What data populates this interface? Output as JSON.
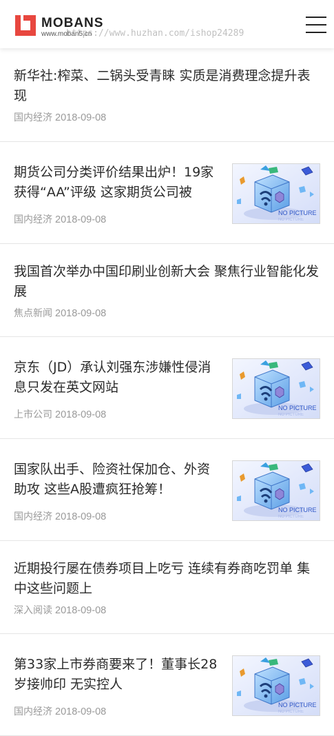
{
  "header": {
    "logo_name": "MOBANS",
    "logo_url": "www.moban5.cn",
    "watermark": "https://www.huzhan.com/ishop24289",
    "menu_icon": "hamburger-menu-icon"
  },
  "thumb": {
    "label": "NO PICTURE",
    "icon": "no-picture-placeholder-image"
  },
  "articles": [
    {
      "title": "新华社:榨菜、二锅头受青睐 实质是消费理念提升表现",
      "category": "国内经济",
      "date": "2018-09-08",
      "has_image": false
    },
    {
      "title": "期货公司分类评价结果出炉！19家获得“AA”评级 这家期货公司被",
      "category": "国内经济",
      "date": "2018-09-08",
      "has_image": true
    },
    {
      "title": "我国首次举办中国印刷业创新大会 聚焦行业智能化发展",
      "category": "焦点新闻",
      "date": "2018-09-08",
      "has_image": false
    },
    {
      "title": "京东（JD）承认刘强东涉嫌性侵消息只发在英文网站",
      "category": "上市公司",
      "date": "2018-09-08",
      "has_image": true
    },
    {
      "title": "国家队出手、险资社保加仓、外资助攻 这些A股遭疯狂抢筹！",
      "category": "国内经济",
      "date": "2018-09-08",
      "has_image": true
    },
    {
      "title": "近期投行屡在债券项目上吃亏 连续有券商吃罚单 集中这些问题上",
      "category": "深入阅读",
      "date": "2018-09-08",
      "has_image": false
    },
    {
      "title": "第33家上市券商要来了！董事长28岁接帅印 无实控人",
      "category": "国内经济",
      "date": "2018-09-08",
      "has_image": true
    }
  ]
}
